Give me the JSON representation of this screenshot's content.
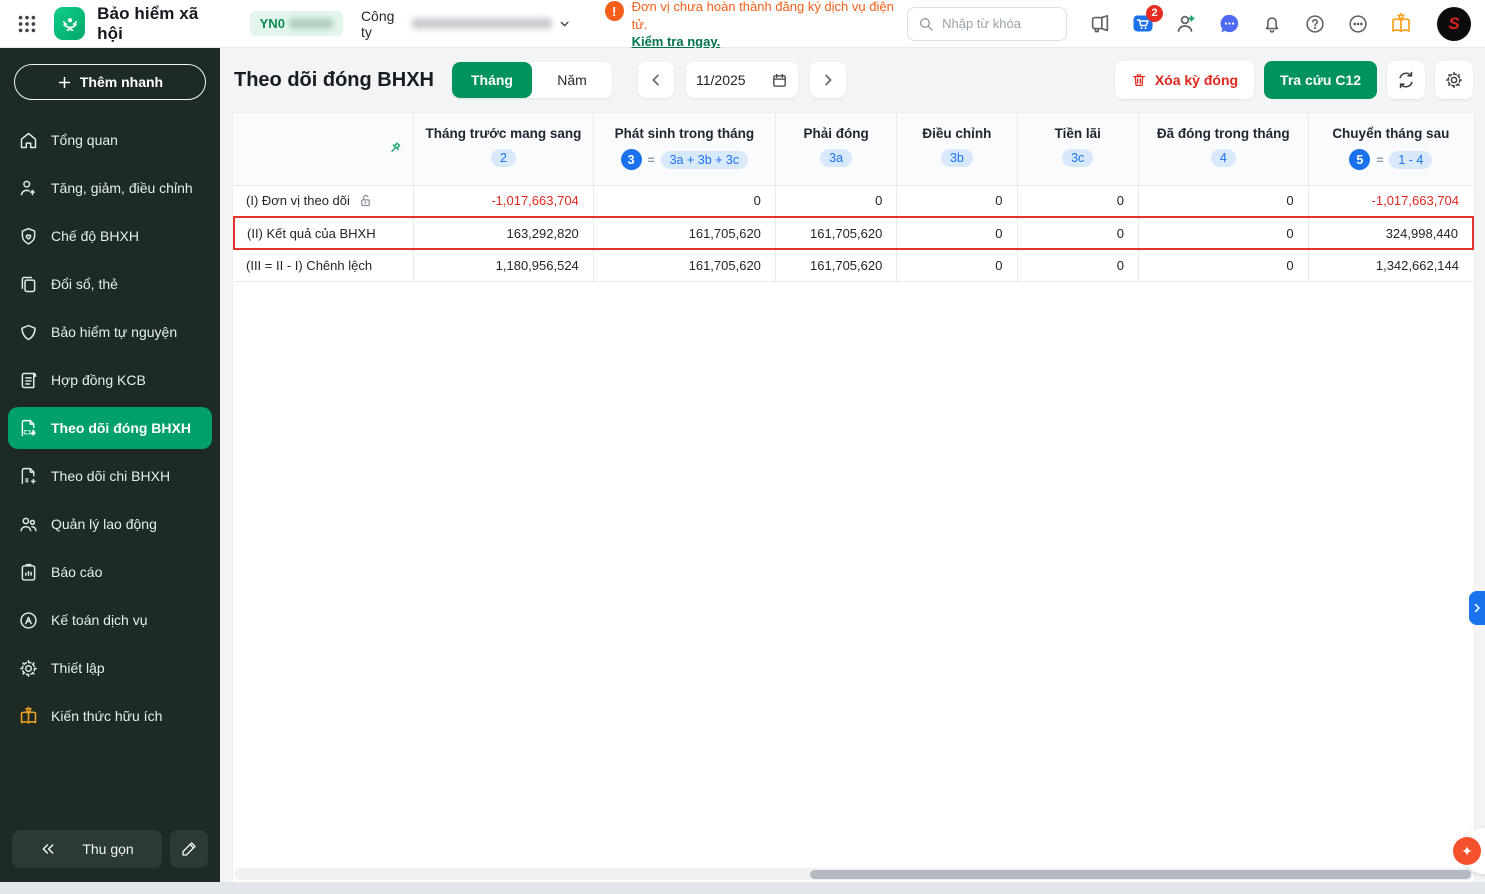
{
  "header": {
    "app_title": "Bảo hiểm xã hội",
    "company_code_prefix": "YN0",
    "company_label": "Công ty",
    "warning_text": "Đơn vị chưa hoàn thành đăng ký dịch vụ điện tử.",
    "warning_link": "Kiểm tra ngay.",
    "warning_mark": "!",
    "search_placeholder": "Nhập từ khóa",
    "cart_badge": "2",
    "avatar_glyph": "S",
    "icons": [
      "apps-grid-icon",
      "megaphone-icon",
      "cart-icon",
      "user-add-icon",
      "chat-icon",
      "bell-icon",
      "help-icon",
      "more-icon",
      "knowledge-icon"
    ]
  },
  "sidebar": {
    "quick_add_label": "Thêm nhanh",
    "collapse_label": "Thu gọn",
    "items": [
      {
        "label": "Tổng quan",
        "icon": "home-icon"
      },
      {
        "label": "Tăng, giảm, điều chỉnh",
        "icon": "user-arrow-icon"
      },
      {
        "label": "Chế độ BHXH",
        "icon": "shield-heart-icon"
      },
      {
        "label": "Đổi sổ, thẻ",
        "icon": "copy-icon"
      },
      {
        "label": "Bảo hiểm tự nguyện",
        "icon": "shield-icon"
      },
      {
        "label": "Hợp đồng KCB",
        "icon": "contract-icon"
      },
      {
        "label": "Theo dõi đóng BHXH",
        "icon": "doc-c12-icon",
        "active": true
      },
      {
        "label": "Theo dõi chi BHXH",
        "icon": "doc-c8-icon"
      },
      {
        "label": "Quản lý lao động",
        "icon": "people-icon"
      },
      {
        "label": "Báo cáo",
        "icon": "report-icon"
      },
      {
        "label": "Kế toán dịch vụ",
        "icon": "accounting-icon"
      },
      {
        "label": "Thiết lập",
        "icon": "gear-icon"
      },
      {
        "label": "Kiến thức hữu ích",
        "icon": "knowledge-icon"
      }
    ]
  },
  "toolbar": {
    "page_title": "Theo dõi đóng BHXH",
    "period_month": "Tháng",
    "period_year": "Năm",
    "date_value": "11/2025",
    "delete_button": "Xóa kỳ đóng",
    "lookup_button": "Tra cứu C12"
  },
  "table": {
    "columns": [
      {
        "title": "Tháng trước mang sang",
        "badge": "2"
      },
      {
        "title": "Phát sinh trong tháng",
        "badge_solid": "3",
        "eq": "=",
        "badge_light": "3a + 3b + 3c"
      },
      {
        "title": "Phải đóng",
        "badge": "3a"
      },
      {
        "title": "Điều chỉnh",
        "badge": "3b"
      },
      {
        "title": "Tiền lãi",
        "badge": "3c"
      },
      {
        "title": "Đã đóng trong tháng",
        "badge": "4"
      },
      {
        "title": "Chuyển tháng sau",
        "badge_solid": "5",
        "eq": "=",
        "badge_light": "1 - 4"
      }
    ],
    "rows": [
      {
        "label": "(I) Đơn vị theo dõi",
        "values": [
          "-1,017,663,704",
          "0",
          "0",
          "0",
          "0",
          "0",
          "-1,017,663,704"
        ]
      },
      {
        "label": "(II) Kết quả của BHXH",
        "values": [
          "163,292,820",
          "161,705,620",
          "161,705,620",
          "0",
          "0",
          "0",
          "324,998,440"
        ]
      },
      {
        "label": "(III = II - I) Chênh lệch",
        "values": [
          "1,180,956,524",
          "161,705,620",
          "161,705,620",
          "0",
          "0",
          "0",
          "1,342,662,144"
        ]
      }
    ]
  },
  "floating": {
    "fab_glyph": "✦"
  },
  "colors": {
    "primary_green": "#00935d",
    "sidebar_bg": "#1e2b25",
    "active_item": "#00a06a",
    "warning_orange": "#f4601c",
    "danger_red": "#e3261c",
    "badge_blue": "#1a72ee",
    "badge_blue_light": "#d9e9fc"
  }
}
